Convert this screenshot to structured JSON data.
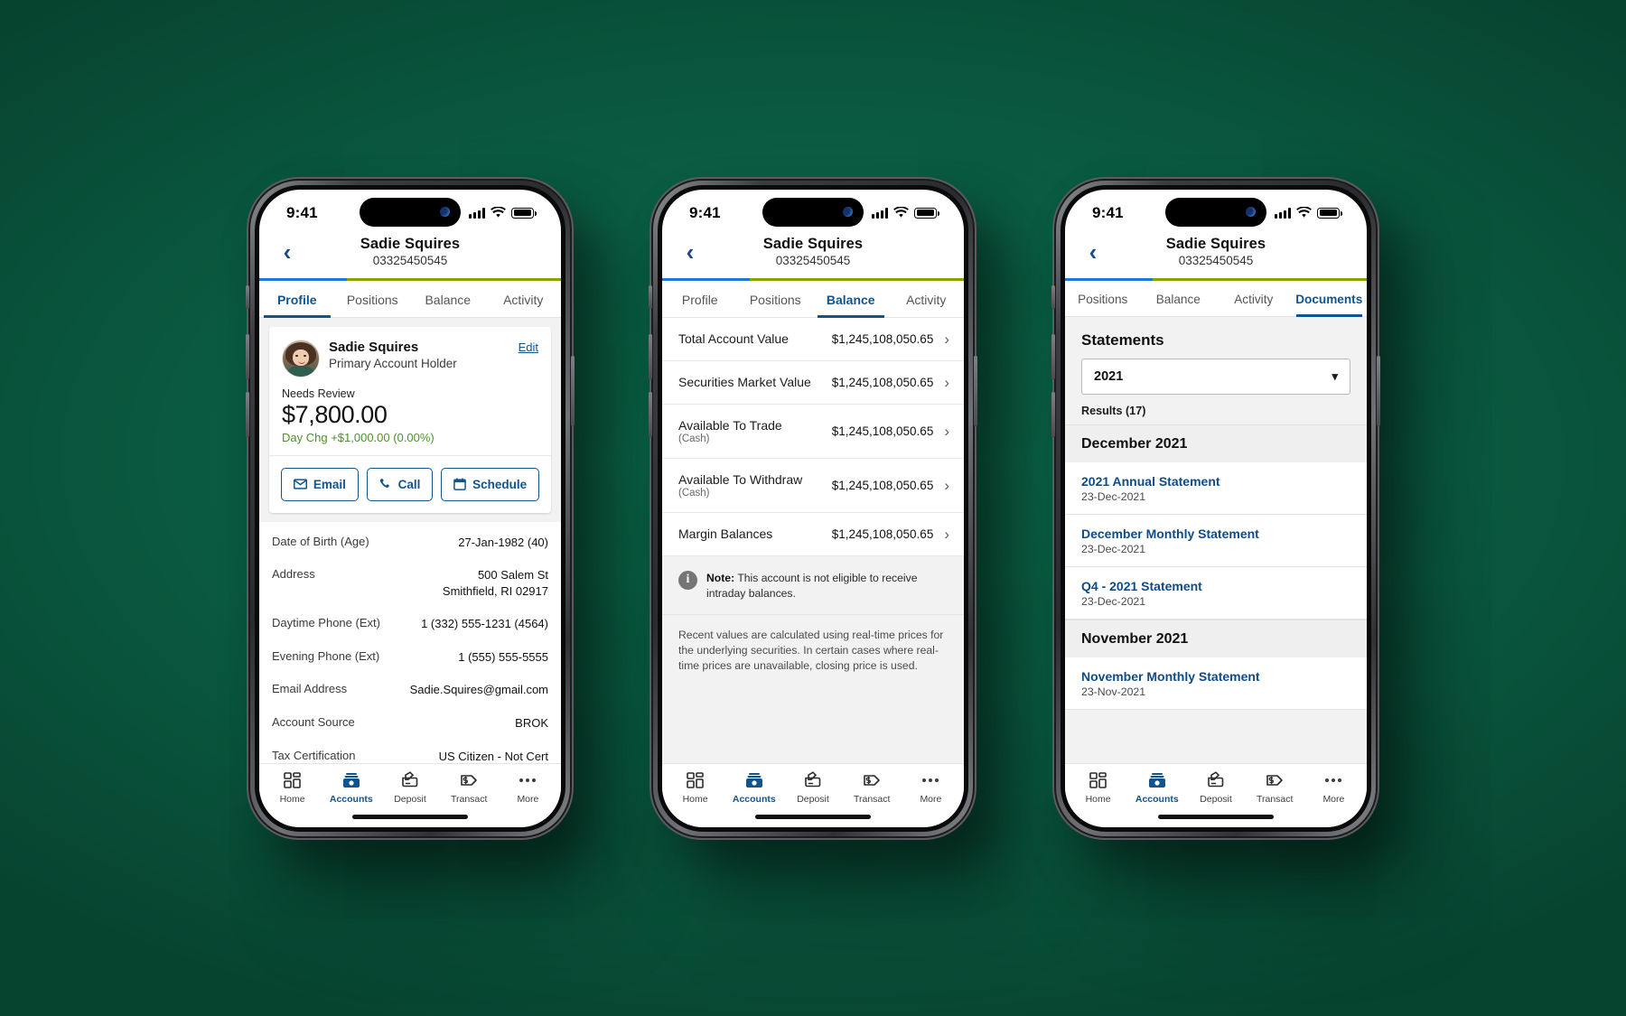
{
  "background_color": "#0b6045",
  "status_bar": {
    "time": "9:41",
    "signal_icon": "cellular-signal-icon",
    "wifi_icon": "wifi-icon",
    "battery_icon": "battery-icon"
  },
  "header": {
    "back_icon": "back-chevron-icon",
    "name": "Sadie Squires",
    "account_number": "03325450545"
  },
  "bottom_nav": {
    "items": [
      {
        "label": "Home",
        "icon": "home-grid-icon",
        "active": false
      },
      {
        "label": "Accounts",
        "icon": "accounts-wallet-icon",
        "active": true
      },
      {
        "label": "Deposit",
        "icon": "deposit-check-icon",
        "active": false
      },
      {
        "label": "Transact",
        "icon": "transact-dollar-tag-icon",
        "active": false
      },
      {
        "label": "More",
        "icon": "more-ellipsis-icon",
        "active": false
      }
    ]
  },
  "phone1": {
    "tabs": [
      {
        "label": "Profile",
        "active": true
      },
      {
        "label": "Positions",
        "active": false
      },
      {
        "label": "Balance",
        "active": false
      },
      {
        "label": "Activity",
        "active": false
      }
    ],
    "profile_card": {
      "avatar_icon": "user-photo-avatar",
      "name": "Sadie Squires",
      "role": "Primary Account Holder",
      "edit_label": "Edit",
      "status_label": "Needs Review",
      "amount": "$7,800.00",
      "day_change": "Day Chg +$1,000.00 (0.00%)",
      "day_change_color": "#4f8f2e",
      "actions": [
        {
          "label": "Email",
          "icon": "envelope-icon"
        },
        {
          "label": "Call",
          "icon": "phone-handset-icon"
        },
        {
          "label": "Schedule",
          "icon": "calendar-icon"
        }
      ]
    },
    "details": [
      {
        "label": "Date of Birth (Age)",
        "value": "27-Jan-1982 (40)"
      },
      {
        "label": "Address",
        "value": "500 Salem St\nSmithfield, RI 02917"
      },
      {
        "label": "Daytime Phone (Ext)",
        "value": "1 (332) 555-1231 (4564)"
      },
      {
        "label": "Evening Phone (Ext)",
        "value": "1 (555) 555-5555"
      },
      {
        "label": "Email Address",
        "value": "Sadie.Squires@gmail.com"
      },
      {
        "label": "Account Source",
        "value": "BROK"
      },
      {
        "label": "Tax Certification",
        "value": "US Citizen - Not Cert"
      }
    ]
  },
  "phone2": {
    "tabs": [
      {
        "label": "Profile",
        "active": false
      },
      {
        "label": "Positions",
        "active": false
      },
      {
        "label": "Balance",
        "active": true
      },
      {
        "label": "Activity",
        "active": false
      }
    ],
    "balances": [
      {
        "label": "Total Account Value",
        "sub": "",
        "value": "$1,245,108,050.65"
      },
      {
        "label": "Securities Market Value",
        "sub": "",
        "value": "$1,245,108,050.65"
      },
      {
        "label": "Available To Trade",
        "sub": "(Cash)",
        "value": "$1,245,108,050.65"
      },
      {
        "label": "Available To Withdraw",
        "sub": "(Cash)",
        "value": "$1,245,108,050.65"
      },
      {
        "label": "Margin Balances",
        "sub": "",
        "value": "$1,245,108,050.65"
      }
    ],
    "note": {
      "icon": "info-circle-icon",
      "bold": "Note:",
      "text": " This account is not eligible to receive intraday balances."
    },
    "disclaimer": "Recent values are calculated using real-time prices for the underlying securities. In certain cases where real-time prices are unavailable, closing price is used."
  },
  "phone3": {
    "tabs": [
      {
        "label": "Positions",
        "active": false
      },
      {
        "label": "Balance",
        "active": false
      },
      {
        "label": "Activity",
        "active": false
      },
      {
        "label": "Documents",
        "active": true
      }
    ],
    "section_title": "Statements",
    "year_select": {
      "value": "2021",
      "chevron_icon": "chevron-down-icon"
    },
    "results_label": "Results (17)",
    "groups": [
      {
        "month": "December 2021",
        "documents": [
          {
            "title": "2021 Annual Statement",
            "date": "23-Dec-2021"
          },
          {
            "title": "December Monthly Statement",
            "date": "23-Dec-2021"
          },
          {
            "title": "Q4 - 2021 Statement",
            "date": "23-Dec-2021"
          }
        ]
      },
      {
        "month": "November 2021",
        "documents": [
          {
            "title": "November Monthly Statement",
            "date": "23-Nov-2021"
          }
        ]
      }
    ]
  }
}
